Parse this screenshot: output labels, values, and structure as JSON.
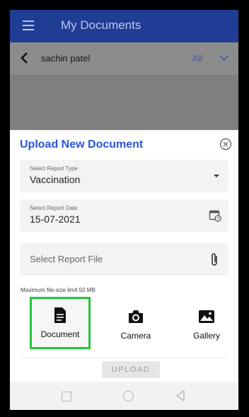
{
  "app_bar": {
    "title": "My Documents",
    "menu_icon": "hamburger-menu-icon"
  },
  "sub_header": {
    "patient_name": "sachin patel",
    "filter_value": "All",
    "back_icon": "chevron-left-icon",
    "filter_icon": "chevron-down-icon"
  },
  "sheet": {
    "title": "Upload New Document",
    "close_icon": "close-circle-icon",
    "report_type": {
      "label": "Select Report Type",
      "value": "Vaccination",
      "icon": "dropdown-arrow-icon"
    },
    "report_date": {
      "label": "Select Report Date",
      "value": "15-07-2021",
      "icon": "calendar-icon"
    },
    "report_file": {
      "placeholder": "Select Report File",
      "icon": "paperclip-icon"
    },
    "file_limit": "Maximum file-size limit 50 MB",
    "options": [
      {
        "label": "Document",
        "icon": "document-icon",
        "selected": true
      },
      {
        "label": "Camera",
        "icon": "camera-icon",
        "selected": false
      },
      {
        "label": "Gallery",
        "icon": "gallery-icon",
        "selected": false
      }
    ],
    "upload_label": "UPLOAD"
  },
  "colors": {
    "primary": "#1f3d95",
    "accent_title": "#2b56d6",
    "selection": "#22c73a",
    "overlay": "#7f7f7f"
  }
}
